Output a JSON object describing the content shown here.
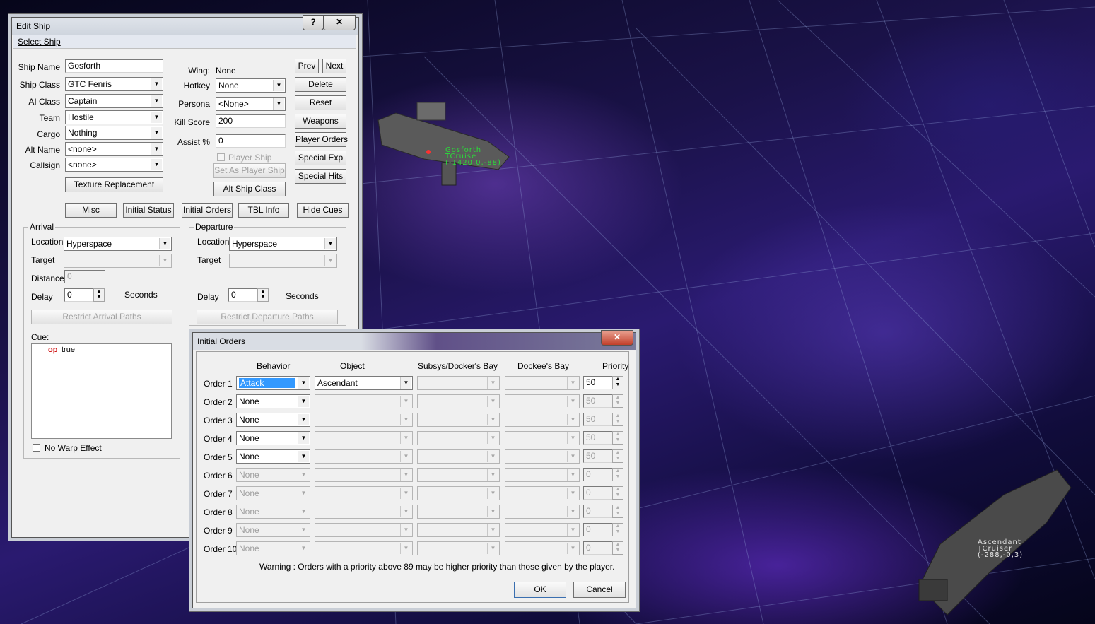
{
  "edit_ship": {
    "title": "Edit Ship",
    "help_label": "?",
    "close_label": "✕",
    "menu_select_ship": "Select Ship",
    "labels": {
      "ship_name": "Ship Name",
      "ship_class": "Ship Class",
      "ai_class": "AI Class",
      "team": "Team",
      "cargo": "Cargo",
      "alt_name": "Alt Name",
      "callsign": "Callsign",
      "wing": "Wing:",
      "hotkey": "Hotkey",
      "persona": "Persona",
      "kill_score": "Kill Score",
      "assist": "Assist %"
    },
    "values": {
      "ship_name": "Gosforth",
      "ship_class": "GTC Fenris",
      "ai_class": "Captain",
      "team": "Hostile",
      "cargo": "Nothing",
      "alt_name": "<none>",
      "callsign": "<none>",
      "wing": "None",
      "hotkey": "None",
      "persona": "<None>",
      "kill_score": "200",
      "assist": "0"
    },
    "player_ship_label": "Player Ship",
    "buttons": {
      "prev": "Prev",
      "next": "Next",
      "delete": "Delete",
      "reset": "Reset",
      "weapons": "Weapons",
      "player_orders": "Player Orders",
      "special_exp": "Special Exp",
      "special_hits": "Special Hits",
      "texture_replacement": "Texture Replacement",
      "set_as_player_ship": "Set As Player Ship",
      "alt_ship_class": "Alt Ship Class",
      "misc": "Misc",
      "initial_status": "Initial Status",
      "initial_orders": "Initial Orders",
      "tbl_info": "TBL Info",
      "hide_cues": "Hide Cues"
    },
    "arrival": {
      "title": "Arrival",
      "location_label": "Location",
      "location": "Hyperspace",
      "target_label": "Target",
      "distance_label": "Distance",
      "distance": "0",
      "delay_label": "Delay",
      "delay": "0",
      "seconds": "Seconds",
      "restrict_label": "Restrict Arrival Paths",
      "cue_label": "Cue:",
      "cue_op": "op",
      "cue_value": "true",
      "no_warp_label": "No Warp Effect"
    },
    "departure": {
      "title": "Departure",
      "location_label": "Location",
      "location": "Hyperspace",
      "target_label": "Target",
      "delay_label": "Delay",
      "delay": "0",
      "seconds": "Seconds",
      "restrict_label": "Restrict Departure Paths"
    }
  },
  "initial_orders": {
    "title": "Initial Orders",
    "close_label": "✕",
    "headers": {
      "behavior": "Behavior",
      "object": "Object",
      "subsys": "Subsys/Docker's Bay",
      "dockee": "Dockee's Bay",
      "priority": "Priority"
    },
    "orders": [
      {
        "label": "Order 1",
        "behavior": "Attack",
        "object": "Ascendant",
        "priority": "50",
        "enabled": true,
        "selected": true,
        "object_enabled": true
      },
      {
        "label": "Order 2",
        "behavior": "None",
        "object": "",
        "priority": "50",
        "enabled": true
      },
      {
        "label": "Order 3",
        "behavior": "None",
        "object": "",
        "priority": "50",
        "enabled": true
      },
      {
        "label": "Order 4",
        "behavior": "None",
        "object": "",
        "priority": "50",
        "enabled": true
      },
      {
        "label": "Order 5",
        "behavior": "None",
        "object": "",
        "priority": "50",
        "enabled": true
      },
      {
        "label": "Order 6",
        "behavior": "None",
        "object": "",
        "priority": "0",
        "enabled": false
      },
      {
        "label": "Order 7",
        "behavior": "None",
        "object": "",
        "priority": "0",
        "enabled": false
      },
      {
        "label": "Order 8",
        "behavior": "None",
        "object": "",
        "priority": "0",
        "enabled": false
      },
      {
        "label": "Order 9",
        "behavior": "None",
        "object": "",
        "priority": "0",
        "enabled": false
      },
      {
        "label": "Order 10",
        "behavior": "None",
        "object": "",
        "priority": "0",
        "enabled": false
      }
    ],
    "warning": "Warning : Orders with a priority above 89 may be higher priority than those given by the player.",
    "ok_label": "OK",
    "cancel_label": "Cancel"
  },
  "viewport": {
    "ship1": {
      "name": "Gosforth",
      "class": "TCruise",
      "coords": "(-1420,0,-88)",
      "color": "#2bdc3a"
    },
    "ship2": {
      "name": "Ascendant",
      "class": "TCruiser",
      "coords": "(-288,-0,3)",
      "color": "#e6e6e6"
    }
  }
}
